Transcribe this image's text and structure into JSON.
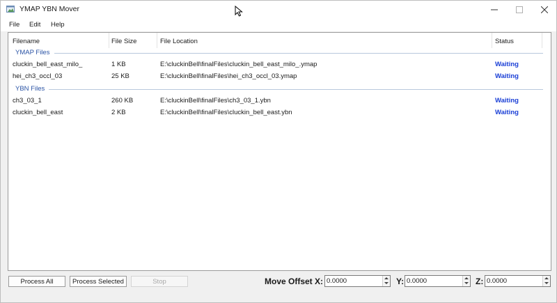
{
  "window": {
    "title": "YMAP YBN Mover"
  },
  "menu": [
    "File",
    "Edit",
    "Help"
  ],
  "columns": [
    "Filename",
    "File Size",
    "File Location",
    "Status"
  ],
  "groups": [
    {
      "label": "YMAP Files",
      "rows": [
        {
          "filename": "cluckin_bell_east_milo_",
          "size": "1 KB",
          "location": "E:\\cluckinBell\\finalFiles\\cluckin_bell_east_milo_.ymap",
          "status": "Waiting"
        },
        {
          "filename": "hei_ch3_occl_03",
          "size": "25 KB",
          "location": "E:\\cluckinBell\\finalFiles\\hei_ch3_occl_03.ymap",
          "status": "Waiting"
        }
      ]
    },
    {
      "label": "YBN Files",
      "rows": [
        {
          "filename": "ch3_03_1",
          "size": "260 KB",
          "location": "E:\\cluckinBell\\finalFiles\\ch3_03_1.ybn",
          "status": "Waiting"
        },
        {
          "filename": "cluckin_bell_east",
          "size": "2 KB",
          "location": "E:\\cluckinBell\\finalFiles\\cluckin_bell_east.ybn",
          "status": "Waiting"
        }
      ]
    }
  ],
  "buttons": {
    "process_all": "Process All",
    "process_selected": "Process Selected",
    "stop": "Stop"
  },
  "offset": {
    "label_x": "Move Offset X:",
    "value_x": "0.0000",
    "label_y": "Y:",
    "value_y": "0.0000",
    "label_z": "Z:",
    "value_z": "0.0000"
  },
  "colors": {
    "status_waiting": "#1a3fd6",
    "group_label": "#2a53a5"
  },
  "icons": {
    "app": "app-icon",
    "minimize": "minimize-icon",
    "maximize": "maximize-icon",
    "close": "close-icon",
    "cursor": "mouse-cursor-icon"
  }
}
